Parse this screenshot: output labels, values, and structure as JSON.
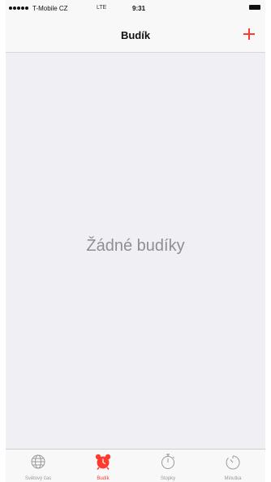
{
  "status_bar": {
    "carrier": "T-Mobile CZ",
    "network": "LTE",
    "time": "9:31"
  },
  "nav": {
    "title": "Budík",
    "add_icon": "plus-icon"
  },
  "main": {
    "empty_message": "Žádné budíky"
  },
  "tab_bar": {
    "tabs": [
      {
        "label": "Světový čas",
        "icon": "globe-icon",
        "active": false
      },
      {
        "label": "Budík",
        "icon": "alarm-clock-icon",
        "active": true
      },
      {
        "label": "Stopky",
        "icon": "stopwatch-icon",
        "active": false
      },
      {
        "label": "Minutka",
        "icon": "timer-icon",
        "active": false
      }
    ]
  },
  "colors": {
    "accent": "#ff3b30",
    "background": "#efeff4",
    "inactive": "#9a9a9f"
  }
}
